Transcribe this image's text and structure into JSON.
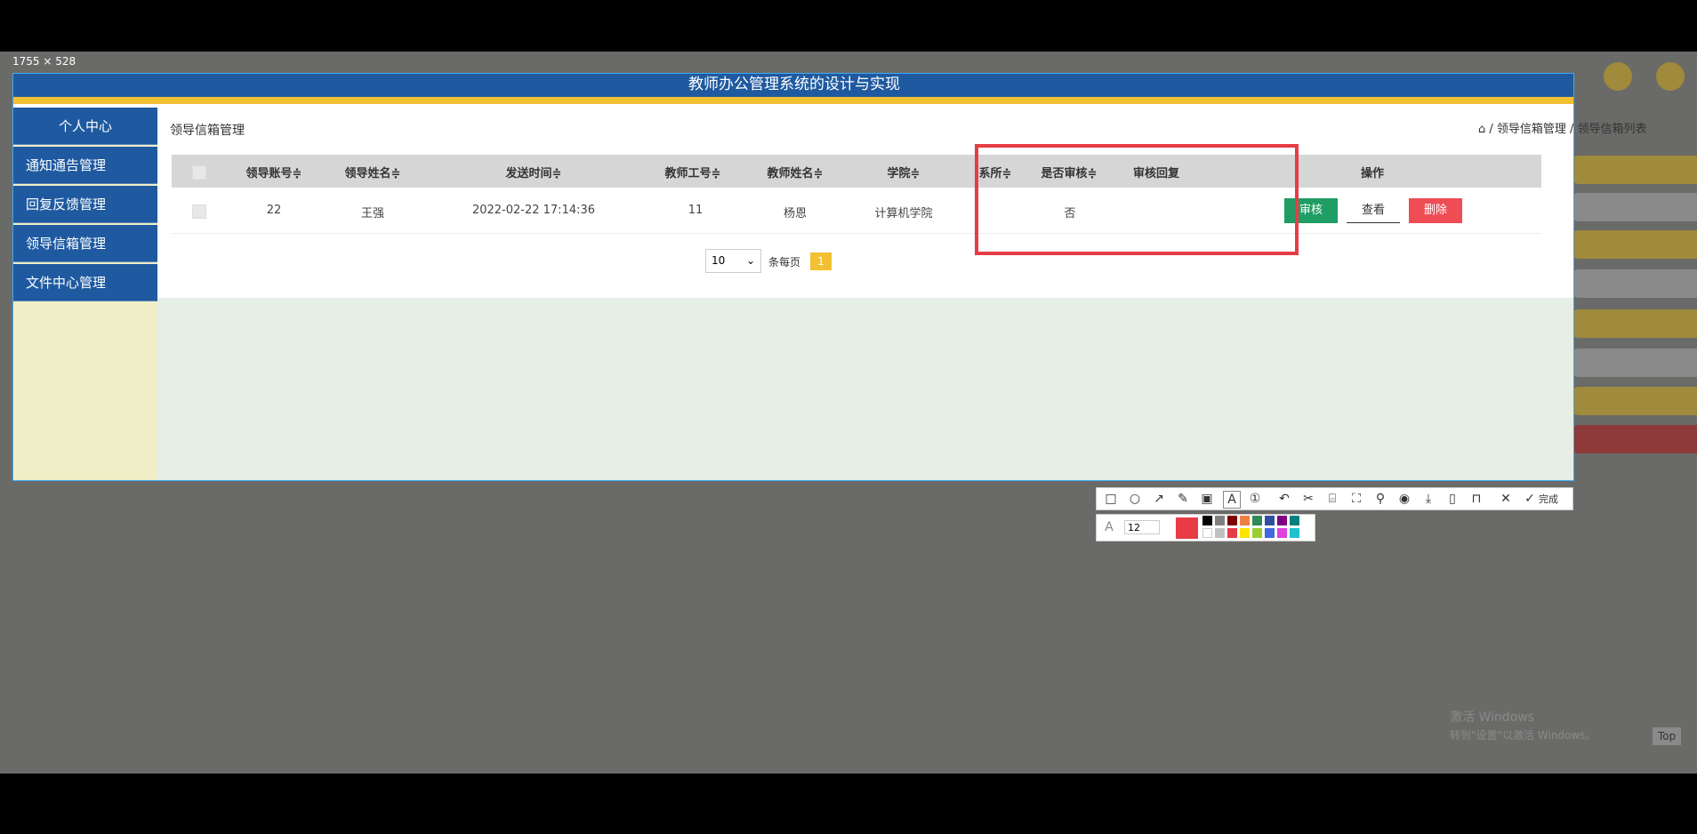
{
  "overlay": {
    "size_readout": "1755 × 528"
  },
  "app": {
    "title": "教师办公管理系统的设计与实现"
  },
  "sidebar": {
    "items": [
      {
        "label": "个人中心"
      },
      {
        "label": "通知通告管理"
      },
      {
        "label": "回复反馈管理"
      },
      {
        "label": "领导信箱管理"
      },
      {
        "label": "文件中心管理"
      }
    ]
  },
  "main": {
    "panel_title": "领导信箱管理",
    "breadcrumb": "⌂ / 领导信箱管理 / 领导信箱列表"
  },
  "table": {
    "headers": [
      "领导账号≑",
      "领导姓名≑",
      "发送时间≑",
      "教师工号≑",
      "教师姓名≑",
      "学院≑",
      "系所≑",
      "是否审核≑",
      "审核回复",
      "操作"
    ],
    "rows": [
      {
        "cells": [
          "22",
          "王强",
          "2022-02-22 17:14:36",
          "11",
          "杨恩",
          "计算机学院",
          "",
          "否",
          ""
        ]
      }
    ],
    "actions": {
      "review": "审核",
      "view": "查看",
      "delete": "删除"
    }
  },
  "pagination": {
    "page_size": "10",
    "per_page_label": "条每页",
    "current_page": "1"
  },
  "right_buttons": {
    "colors": [
      "#f2c033",
      "#ffffff",
      "#f2c033",
      "#ffffff",
      "#f2c033",
      "#ffffff",
      "#f2c033",
      "#e73c45"
    ]
  },
  "toolbar": {
    "done_label": "完成",
    "font_size": "12"
  },
  "watermark": {
    "line1": "激活 Windows",
    "line2": "转到\"设置\"以激活 Windows。",
    "top_label": "Top"
  },
  "colors": {
    "primary": "#1f5aa0",
    "accent": "#f2c033",
    "annotation": "#e73c45",
    "success": "#1f9d64",
    "danger": "#f04c55"
  }
}
